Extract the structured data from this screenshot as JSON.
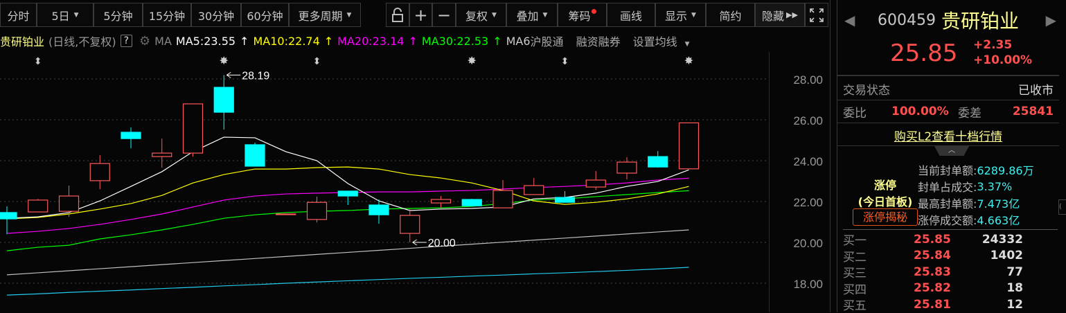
{
  "toolbar": {
    "intraday": "分时",
    "five_day": "5日",
    "m5": "5分钟",
    "m15": "15分钟",
    "m30": "30分钟",
    "m60": "60分钟",
    "more_periods": "更多周期",
    "adjust": "复权",
    "overlay": "叠加",
    "chips": "筹码",
    "draw": "画线",
    "display": "显示",
    "simple": "简约",
    "hide": "隐藏"
  },
  "legend": {
    "title": "贵研铂业",
    "subtitle": "(日线,不复权)",
    "help": "?",
    "ma": "MA",
    "ma5": "MA5:23.55",
    "ma10": "MA10:22.74",
    "ma20": "MA20:23.14",
    "ma30": "MA30:22.53",
    "ma60": "MA6",
    "hsgt": "沪股通",
    "margin": "融资融券",
    "set_ma": "设置均线"
  },
  "colors": {
    "up": "#ff5a5a",
    "down": "#00ffff",
    "ma5": "#ffffff",
    "ma10": "#ffff00",
    "ma20": "#ff00ff",
    "ma30": "#00ff00",
    "ma60": "#c0c0c0",
    "ma_long": "#22ccee"
  },
  "chart_data": {
    "type": "candlestick",
    "ylim": [
      17.3,
      29
    ],
    "y_ticks": [
      "28.00",
      "26.00",
      "24.00",
      "22.00",
      "20.00",
      "18.00"
    ],
    "y_tick_values": [
      28,
      26,
      24,
      22,
      20,
      18
    ],
    "annotations": [
      {
        "index": 7,
        "price": 28.19,
        "label": "28.19"
      },
      {
        "index": 13,
        "price": 20.0,
        "label": "20.00"
      }
    ],
    "event_markers": [
      {
        "index": 1,
        "icon": "updown-arrow"
      },
      {
        "index": 7,
        "icon": "star"
      },
      {
        "index": 10,
        "icon": "updown-arrow"
      },
      {
        "index": 15,
        "icon": "star"
      },
      {
        "index": 18,
        "icon": "updown-arrow"
      },
      {
        "index": 22,
        "icon": "star"
      }
    ],
    "candles": [
      {
        "o": 21.46,
        "h": 21.76,
        "l": 20.4,
        "c": 21.15
      },
      {
        "o": 21.49,
        "h": 22.13,
        "l": 21.49,
        "c": 22.07
      },
      {
        "o": 21.52,
        "h": 22.78,
        "l": 21.25,
        "c": 22.27
      },
      {
        "o": 23.02,
        "h": 24.27,
        "l": 22.6,
        "c": 23.86
      },
      {
        "o": 25.39,
        "h": 25.63,
        "l": 24.6,
        "c": 25.08
      },
      {
        "o": 24.2,
        "h": 25.08,
        "l": 23.66,
        "c": 24.37
      },
      {
        "o": 24.37,
        "h": 26.78,
        "l": 24.2,
        "c": 26.78
      },
      {
        "o": 27.59,
        "h": 28.19,
        "l": 25.52,
        "c": 26.37
      },
      {
        "o": 24.78,
        "h": 24.88,
        "l": 23.73,
        "c": 23.73
      },
      {
        "o": 21.39,
        "h": 21.39,
        "l": 21.39,
        "c": 21.39
      },
      {
        "o": 21.12,
        "h": 22.24,
        "l": 20.98,
        "c": 21.96
      },
      {
        "o": 22.51,
        "h": 22.51,
        "l": 21.83,
        "c": 22.27
      },
      {
        "o": 21.83,
        "h": 22.1,
        "l": 20.91,
        "c": 21.35
      },
      {
        "o": 20.44,
        "h": 21.63,
        "l": 20.0,
        "c": 21.32
      },
      {
        "o": 21.93,
        "h": 22.27,
        "l": 21.69,
        "c": 22.1
      },
      {
        "o": 22.1,
        "h": 22.13,
        "l": 21.76,
        "c": 21.79
      },
      {
        "o": 21.69,
        "h": 23.05,
        "l": 21.69,
        "c": 22.54
      },
      {
        "o": 22.34,
        "h": 23.15,
        "l": 22.34,
        "c": 22.78
      },
      {
        "o": 22.2,
        "h": 22.51,
        "l": 21.96,
        "c": 21.96
      },
      {
        "o": 22.71,
        "h": 23.49,
        "l": 22.57,
        "c": 23.05
      },
      {
        "o": 23.39,
        "h": 24.17,
        "l": 23.08,
        "c": 23.93
      },
      {
        "o": 24.2,
        "h": 24.47,
        "l": 23.66,
        "c": 23.69
      },
      {
        "o": 23.6,
        "h": 25.85,
        "l": 23.6,
        "c": 25.85
      }
    ],
    "ma5": [
      21.18,
      21.25,
      21.46,
      22.03,
      22.74,
      23.46,
      24.44,
      25.15,
      25.12,
      24.44,
      24.0,
      22.88,
      22.03,
      21.56,
      21.63,
      21.66,
      21.73,
      22.13,
      22.2,
      22.41,
      22.74,
      22.98,
      23.55
    ],
    "ma10": [
      21.15,
      21.22,
      21.39,
      21.63,
      21.9,
      22.3,
      22.91,
      23.32,
      23.59,
      23.59,
      23.66,
      23.69,
      23.59,
      23.32,
      23.15,
      22.91,
      22.54,
      22.03,
      21.86,
      21.96,
      22.13,
      22.37,
      22.74
    ],
    "ma20": [
      20.44,
      20.54,
      20.68,
      20.88,
      21.12,
      21.39,
      21.73,
      22.07,
      22.27,
      22.37,
      22.41,
      22.44,
      22.47,
      22.47,
      22.51,
      22.54,
      22.61,
      22.68,
      22.74,
      22.81,
      22.91,
      23.05,
      23.14
    ],
    "ma30": [
      19.59,
      19.76,
      19.86,
      20.17,
      20.37,
      20.61,
      20.88,
      21.18,
      21.35,
      21.46,
      21.52,
      21.56,
      21.63,
      21.66,
      21.69,
      21.76,
      21.9,
      22.07,
      22.13,
      22.24,
      22.34,
      22.44,
      22.53
    ],
    "ma60": [
      18.41,
      18.51,
      18.61,
      18.71,
      18.81,
      18.91,
      19.01,
      19.11,
      19.21,
      19.31,
      19.41,
      19.51,
      19.61,
      19.71,
      19.81,
      19.91,
      20.01,
      20.11,
      20.21,
      20.31,
      20.41,
      20.51,
      20.61
    ],
    "ma_long": [
      17.42,
      17.48,
      17.55,
      17.61,
      17.67,
      17.74,
      17.8,
      17.87,
      17.93,
      18.0,
      18.06,
      18.12,
      18.18,
      18.24,
      18.29,
      18.35,
      18.4,
      18.46,
      18.51,
      18.57,
      18.63,
      18.7,
      18.78
    ]
  },
  "quote": {
    "code": "600459",
    "name": "贵研铂业",
    "price": "25.85",
    "change": "+2.35",
    "change_pct": "+10.00%",
    "status_label": "交易状态",
    "status": "已收市",
    "ratio_label": "委比",
    "ratio": "100.00%",
    "diff_label": "委差",
    "diff": "25841",
    "l2_link": "购买L2查看十档行情",
    "limit_title": "涨停",
    "limit_sub": "(今日首板)",
    "limit_btn": "涨停揭秘",
    "limit_stats": [
      {
        "label": "当前封单额:",
        "value": "6289.86万"
      },
      {
        "label": "封单占成交:",
        "value": "3.37%"
      },
      {
        "label": "最高封单额:",
        "value": "7.473亿"
      },
      {
        "label": "涨停成交额:",
        "value": "4.663亿"
      }
    ],
    "bids": [
      {
        "label": "买一",
        "price": "25.85",
        "volume": "24332"
      },
      {
        "label": "买二",
        "price": "25.84",
        "volume": "1402"
      },
      {
        "label": "买三",
        "price": "25.83",
        "volume": "77"
      },
      {
        "label": "买四",
        "price": "25.82",
        "volume": "18"
      },
      {
        "label": "买五",
        "price": "25.81",
        "volume": "12"
      }
    ]
  }
}
